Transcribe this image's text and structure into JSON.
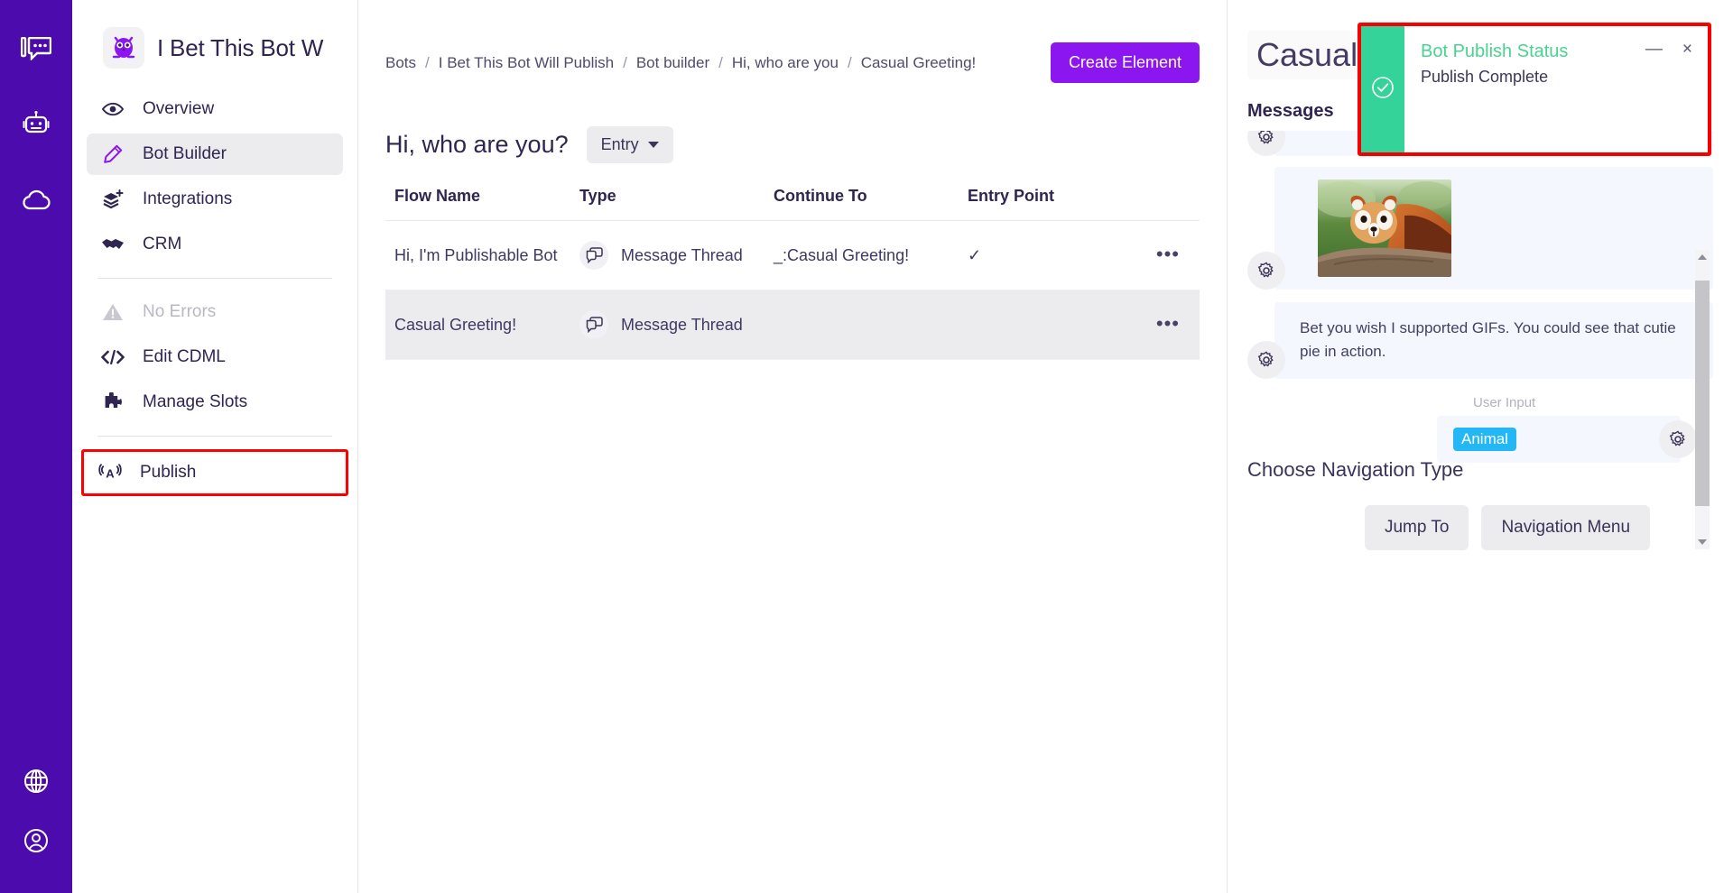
{
  "rail": {
    "items": [
      {
        "name": "chat-logo-icon",
        "label": "Conversation Logo"
      },
      {
        "name": "bot-icon",
        "label": "Bots"
      },
      {
        "name": "cloud-icon",
        "label": "Cloud"
      }
    ],
    "bottom_items": [
      {
        "name": "globe-icon",
        "label": "Language"
      },
      {
        "name": "account-icon",
        "label": "Account"
      }
    ]
  },
  "sidebar": {
    "brand_name": "I Bet This Bot W",
    "brand_logo_name": "owl-logo-icon",
    "items": [
      {
        "label": "Overview",
        "icon": "eye-icon",
        "state": "normal"
      },
      {
        "label": "Bot Builder",
        "icon": "pencil-icon",
        "state": "active"
      },
      {
        "label": "Integrations",
        "icon": "layers-plus-icon",
        "state": "normal"
      },
      {
        "label": "CRM",
        "icon": "handshake-icon",
        "state": "normal"
      }
    ],
    "items2": [
      {
        "label": "No Errors",
        "icon": "warning-triangle-icon",
        "state": "disabled"
      },
      {
        "label": "Edit CDML",
        "icon": "code-icon",
        "state": "normal"
      },
      {
        "label": "Manage Slots",
        "icon": "puzzle-icon",
        "state": "normal"
      }
    ],
    "items3": [
      {
        "label": "Publish",
        "icon": "broadcast-icon",
        "state": "highlighted"
      }
    ]
  },
  "topbar": {
    "breadcrumb": [
      "Bots",
      "I Bet This Bot Will Publish",
      "Bot builder",
      "Hi, who are you",
      "Casual Greeting!"
    ],
    "breadcrumb_separator": "/",
    "create_element_label": "Create Element"
  },
  "flow": {
    "title": "Hi, who are you?",
    "entry_pill_label": "Entry",
    "table": {
      "headers": [
        "Flow Name",
        "Type",
        "Continue To",
        "Entry Point",
        ""
      ],
      "rows": [
        {
          "flow_name": "Hi, I'm Publishable Bot",
          "type": "Message Thread",
          "type_icon": "message-thread-icon",
          "continue_to": "_:Casual Greeting!",
          "entry_point": "✓",
          "menu": "•••",
          "selected": false
        },
        {
          "flow_name": "Casual Greeting!",
          "type": "Message Thread",
          "type_icon": "message-thread-icon",
          "continue_to": "",
          "entry_point": "",
          "menu": "•••",
          "selected": true
        }
      ]
    }
  },
  "rightpanel": {
    "title": "Casual G",
    "messages_label": "Messages",
    "messages": [
      {
        "kind": "image",
        "alt": "red-panda-photo",
        "gear": "gear-icon"
      },
      {
        "kind": "text",
        "text": "Bet you wish I supported GIFs. You could see that cutie pie in action.",
        "gear": "gear-icon"
      }
    ],
    "user_input": {
      "label": "User Input",
      "chip": "Animal",
      "gear": "gear-icon"
    },
    "navigation": {
      "title": "Choose Navigation Type",
      "buttons": [
        "Jump To",
        "Navigation Menu"
      ]
    },
    "scrollbar": {
      "up_arrow": "scroll-up-arrow-icon",
      "down_arrow": "scroll-down-arrow-icon"
    }
  },
  "toast": {
    "title": "Bot Publish Status",
    "subtitle": "Publish Complete",
    "status_icon": "check-circle-icon",
    "minimize_label": "—",
    "close_label": "×",
    "accent_color": "#34d399",
    "title_color": "#4ad38f",
    "highlight_color": "#fe0000"
  },
  "colors": {
    "brand_purple": "#4b0bad",
    "accent_purple": "#8b16f0",
    "chip_blue": "#23b7f5",
    "toast_green": "#34d399",
    "highlight_red": "#fe0000"
  }
}
